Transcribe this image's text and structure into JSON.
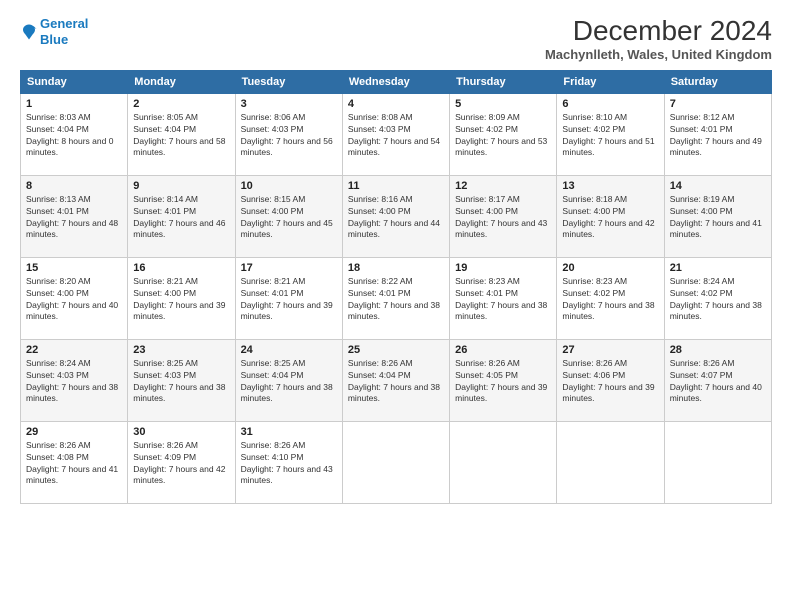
{
  "header": {
    "logo_line1": "General",
    "logo_line2": "Blue",
    "main_title": "December 2024",
    "subtitle": "Machynlleth, Wales, United Kingdom"
  },
  "columns": [
    "Sunday",
    "Monday",
    "Tuesday",
    "Wednesday",
    "Thursday",
    "Friday",
    "Saturday"
  ],
  "weeks": [
    [
      {
        "day": "1",
        "sunrise": "Sunrise: 8:03 AM",
        "sunset": "Sunset: 4:04 PM",
        "daylight": "Daylight: 8 hours and 0 minutes."
      },
      {
        "day": "2",
        "sunrise": "Sunrise: 8:05 AM",
        "sunset": "Sunset: 4:04 PM",
        "daylight": "Daylight: 7 hours and 58 minutes."
      },
      {
        "day": "3",
        "sunrise": "Sunrise: 8:06 AM",
        "sunset": "Sunset: 4:03 PM",
        "daylight": "Daylight: 7 hours and 56 minutes."
      },
      {
        "day": "4",
        "sunrise": "Sunrise: 8:08 AM",
        "sunset": "Sunset: 4:03 PM",
        "daylight": "Daylight: 7 hours and 54 minutes."
      },
      {
        "day": "5",
        "sunrise": "Sunrise: 8:09 AM",
        "sunset": "Sunset: 4:02 PM",
        "daylight": "Daylight: 7 hours and 53 minutes."
      },
      {
        "day": "6",
        "sunrise": "Sunrise: 8:10 AM",
        "sunset": "Sunset: 4:02 PM",
        "daylight": "Daylight: 7 hours and 51 minutes."
      },
      {
        "day": "7",
        "sunrise": "Sunrise: 8:12 AM",
        "sunset": "Sunset: 4:01 PM",
        "daylight": "Daylight: 7 hours and 49 minutes."
      }
    ],
    [
      {
        "day": "8",
        "sunrise": "Sunrise: 8:13 AM",
        "sunset": "Sunset: 4:01 PM",
        "daylight": "Daylight: 7 hours and 48 minutes."
      },
      {
        "day": "9",
        "sunrise": "Sunrise: 8:14 AM",
        "sunset": "Sunset: 4:01 PM",
        "daylight": "Daylight: 7 hours and 46 minutes."
      },
      {
        "day": "10",
        "sunrise": "Sunrise: 8:15 AM",
        "sunset": "Sunset: 4:00 PM",
        "daylight": "Daylight: 7 hours and 45 minutes."
      },
      {
        "day": "11",
        "sunrise": "Sunrise: 8:16 AM",
        "sunset": "Sunset: 4:00 PM",
        "daylight": "Daylight: 7 hours and 44 minutes."
      },
      {
        "day": "12",
        "sunrise": "Sunrise: 8:17 AM",
        "sunset": "Sunset: 4:00 PM",
        "daylight": "Daylight: 7 hours and 43 minutes."
      },
      {
        "day": "13",
        "sunrise": "Sunrise: 8:18 AM",
        "sunset": "Sunset: 4:00 PM",
        "daylight": "Daylight: 7 hours and 42 minutes."
      },
      {
        "day": "14",
        "sunrise": "Sunrise: 8:19 AM",
        "sunset": "Sunset: 4:00 PM",
        "daylight": "Daylight: 7 hours and 41 minutes."
      }
    ],
    [
      {
        "day": "15",
        "sunrise": "Sunrise: 8:20 AM",
        "sunset": "Sunset: 4:00 PM",
        "daylight": "Daylight: 7 hours and 40 minutes."
      },
      {
        "day": "16",
        "sunrise": "Sunrise: 8:21 AM",
        "sunset": "Sunset: 4:00 PM",
        "daylight": "Daylight: 7 hours and 39 minutes."
      },
      {
        "day": "17",
        "sunrise": "Sunrise: 8:21 AM",
        "sunset": "Sunset: 4:01 PM",
        "daylight": "Daylight: 7 hours and 39 minutes."
      },
      {
        "day": "18",
        "sunrise": "Sunrise: 8:22 AM",
        "sunset": "Sunset: 4:01 PM",
        "daylight": "Daylight: 7 hours and 38 minutes."
      },
      {
        "day": "19",
        "sunrise": "Sunrise: 8:23 AM",
        "sunset": "Sunset: 4:01 PM",
        "daylight": "Daylight: 7 hours and 38 minutes."
      },
      {
        "day": "20",
        "sunrise": "Sunrise: 8:23 AM",
        "sunset": "Sunset: 4:02 PM",
        "daylight": "Daylight: 7 hours and 38 minutes."
      },
      {
        "day": "21",
        "sunrise": "Sunrise: 8:24 AM",
        "sunset": "Sunset: 4:02 PM",
        "daylight": "Daylight: 7 hours and 38 minutes."
      }
    ],
    [
      {
        "day": "22",
        "sunrise": "Sunrise: 8:24 AM",
        "sunset": "Sunset: 4:03 PM",
        "daylight": "Daylight: 7 hours and 38 minutes."
      },
      {
        "day": "23",
        "sunrise": "Sunrise: 8:25 AM",
        "sunset": "Sunset: 4:03 PM",
        "daylight": "Daylight: 7 hours and 38 minutes."
      },
      {
        "day": "24",
        "sunrise": "Sunrise: 8:25 AM",
        "sunset": "Sunset: 4:04 PM",
        "daylight": "Daylight: 7 hours and 38 minutes."
      },
      {
        "day": "25",
        "sunrise": "Sunrise: 8:26 AM",
        "sunset": "Sunset: 4:04 PM",
        "daylight": "Daylight: 7 hours and 38 minutes."
      },
      {
        "day": "26",
        "sunrise": "Sunrise: 8:26 AM",
        "sunset": "Sunset: 4:05 PM",
        "daylight": "Daylight: 7 hours and 39 minutes."
      },
      {
        "day": "27",
        "sunrise": "Sunrise: 8:26 AM",
        "sunset": "Sunset: 4:06 PM",
        "daylight": "Daylight: 7 hours and 39 minutes."
      },
      {
        "day": "28",
        "sunrise": "Sunrise: 8:26 AM",
        "sunset": "Sunset: 4:07 PM",
        "daylight": "Daylight: 7 hours and 40 minutes."
      }
    ],
    [
      {
        "day": "29",
        "sunrise": "Sunrise: 8:26 AM",
        "sunset": "Sunset: 4:08 PM",
        "daylight": "Daylight: 7 hours and 41 minutes."
      },
      {
        "day": "30",
        "sunrise": "Sunrise: 8:26 AM",
        "sunset": "Sunset: 4:09 PM",
        "daylight": "Daylight: 7 hours and 42 minutes."
      },
      {
        "day": "31",
        "sunrise": "Sunrise: 8:26 AM",
        "sunset": "Sunset: 4:10 PM",
        "daylight": "Daylight: 7 hours and 43 minutes."
      },
      null,
      null,
      null,
      null
    ]
  ]
}
